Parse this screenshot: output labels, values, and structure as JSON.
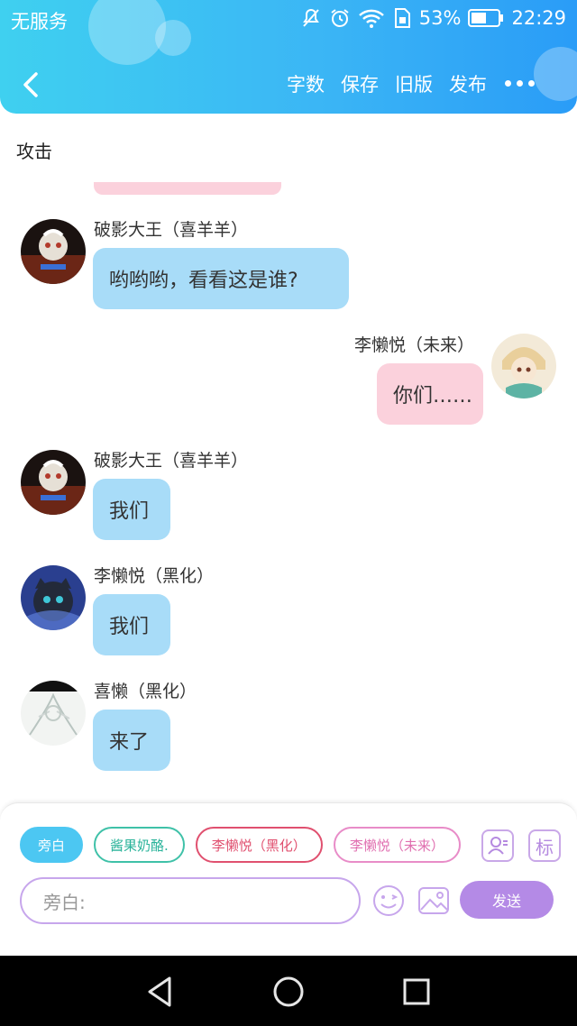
{
  "status_bar": {
    "carrier": "无服务",
    "battery_percent": "53%",
    "time": "22:29",
    "icons": [
      "mute-icon",
      "alarm-icon",
      "wifi-icon",
      "sim-icon",
      "battery-icon"
    ]
  },
  "nav": {
    "back_icon": "chevron-left-icon",
    "actions": [
      "字数",
      "保存",
      "旧版",
      "发布"
    ],
    "more_icon": "more-dots-icon"
  },
  "section_title": "攻击",
  "messages": [
    {
      "side": "left",
      "sender": "破影大王（喜羊羊）",
      "text": "哟哟哟，看看这是谁?",
      "bubble_color": "#a8dcf8"
    },
    {
      "side": "right",
      "sender": "李懒悦（未来）",
      "text": "你们……",
      "bubble_color": "#fbd1dc"
    },
    {
      "side": "left",
      "sender": "破影大王（喜羊羊）",
      "text": "我们",
      "bubble_color": "#a8dcf8"
    },
    {
      "side": "left",
      "sender": "李懒悦（黑化）",
      "text": "我们",
      "bubble_color": "#a8dcf8"
    },
    {
      "side": "left",
      "sender": "喜懒（黑化）",
      "text": "来了",
      "bubble_color": "#a8dcf8"
    }
  ],
  "input_panel": {
    "chips": [
      "旁白",
      "酱果奶酪.",
      "李懒悦（黑化）",
      "李懒悦（未来）"
    ],
    "active_chip": "旁白",
    "tool_icons": [
      "contact-card-icon",
      "tag-icon"
    ],
    "tag_icon_glyph": "标",
    "input_placeholder": "旁白:",
    "emoji_icon": "emoji-icon",
    "image_icon": "image-icon",
    "send_label": "发送"
  },
  "system_nav": [
    "back-triangle-icon",
    "home-circle-icon",
    "recents-square-icon"
  ],
  "colors": {
    "header": "#3bb6f5",
    "accent_purple": "#b48ae6",
    "bubble_blue": "#a8dcf8",
    "bubble_pink": "#fbd1dc"
  }
}
